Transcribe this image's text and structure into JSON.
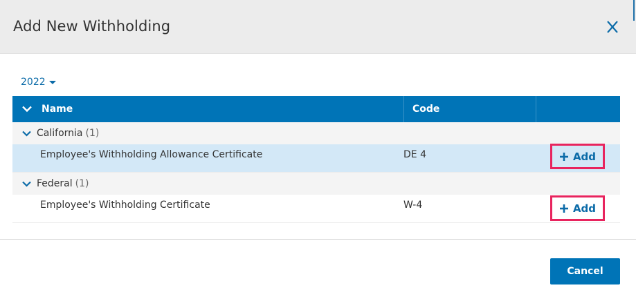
{
  "dialog": {
    "title": "Add New Withholding",
    "close_icon": "close-icon"
  },
  "year_select": {
    "value": "2022",
    "icon": "caret-down-icon"
  },
  "grid": {
    "columns": {
      "name": "Name",
      "code": "Code"
    },
    "groups": [
      {
        "label": "California",
        "count": "(1)",
        "rows": [
          {
            "name": "Employee's Withholding Allowance Certificate",
            "code": "DE 4",
            "action": "Add",
            "selected": true
          }
        ]
      },
      {
        "label": "Federal",
        "count": "(1)",
        "rows": [
          {
            "name": "Employee's Withholding Certificate",
            "code": "W-4",
            "action": "Add",
            "selected": false
          }
        ]
      }
    ]
  },
  "footer": {
    "cancel_label": "Cancel"
  },
  "colors": {
    "primary": "#0074b7",
    "link": "#0b6ba8",
    "highlight_border": "#e8245e",
    "selected_row": "#d3e8f7",
    "header_bg": "#ececec"
  }
}
